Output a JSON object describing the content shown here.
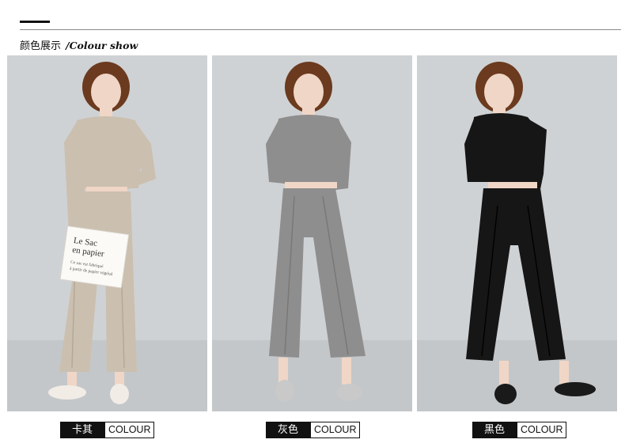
{
  "section": {
    "title_cn": "颜色展示",
    "title_en": "/Colour show"
  },
  "products": [
    {
      "color_cn": "卡其",
      "color_en": "COLOUR",
      "garment_color": "#cbbfaf",
      "shade_color": "#b3a797",
      "shoe_color": "#f1ece6",
      "bag_text": [
        "Le Sac",
        "en papier",
        "Ce sac est fabriqué",
        "à partir de papier végétal"
      ]
    },
    {
      "color_cn": "灰色",
      "color_en": "COLOUR",
      "garment_color": "#8e8e8e",
      "shade_color": "#777777",
      "shoe_color": "#c9c9c9"
    },
    {
      "color_cn": "黑色",
      "color_en": "COLOUR",
      "garment_color": "#161616",
      "shade_color": "#000000",
      "shoe_color": "#1a1a1a"
    }
  ],
  "colors": {
    "backdrop": "#cfd2d4",
    "hair": "#6b3a1f",
    "skin": "#f0d6c6"
  }
}
